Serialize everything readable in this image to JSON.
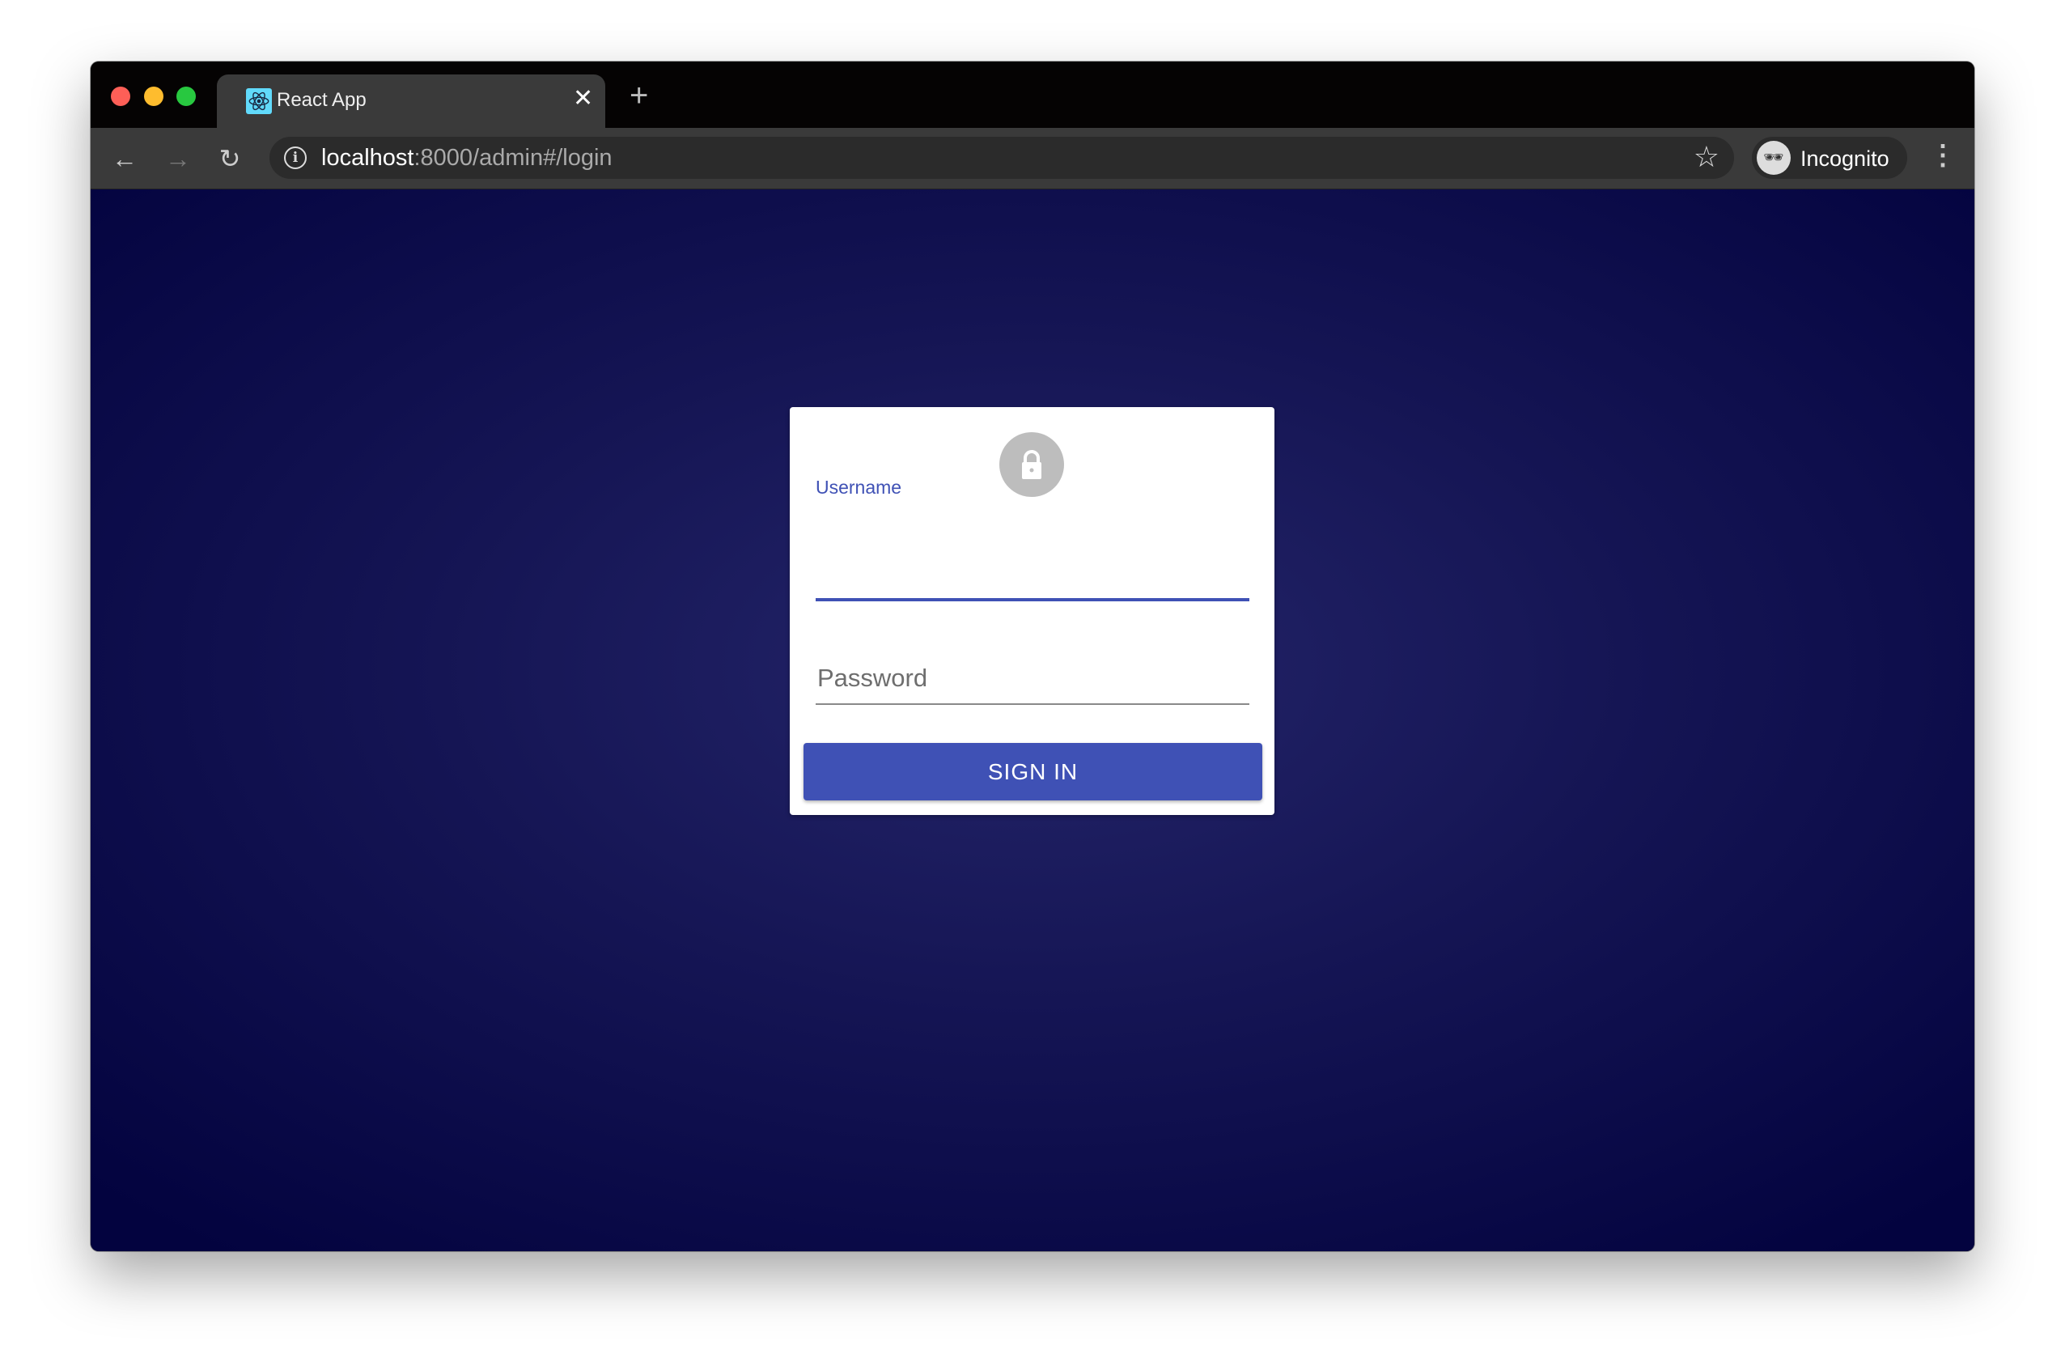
{
  "browser": {
    "tab_title": "React App",
    "close_tab": "✕",
    "new_tab": "+",
    "url_host": "localhost",
    "url_rest": ":8000/admin#/login",
    "profile_label": "Incognito",
    "icons": [
      "react-favicon",
      "back-arrow-icon",
      "forward-arrow-icon",
      "reload-icon",
      "info-icon",
      "star-icon",
      "incognito-icon",
      "kebab-menu-icon"
    ]
  },
  "login": {
    "username_label": "Username",
    "username_value": "",
    "password_placeholder": "Password",
    "sign_in_label": "SIGN IN",
    "icon": "lock-icon"
  },
  "colors": {
    "primary": "#3f51b5",
    "background_center": "#24256a",
    "background_edge": "#03033f"
  }
}
